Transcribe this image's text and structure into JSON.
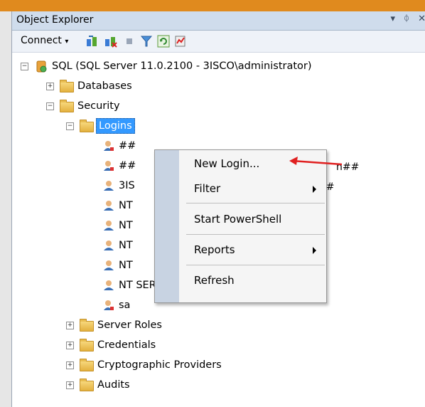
{
  "panel": {
    "title": "Object Explorer",
    "controls": [
      "▾",
      "ᛰ",
      "✕"
    ]
  },
  "toolbar": {
    "connect_label": "Connect",
    "connect_arrow": "▾",
    "icons": [
      "connect-object-explorer-icon",
      "disconnect-icon",
      "stop-icon",
      "filter-icon",
      "refresh-icon",
      "activity-monitor-icon"
    ]
  },
  "tree": {
    "server": "SQL (SQL Server 11.0.2100 - 3ISCO\\administrator)",
    "databases": "Databases",
    "security": "Security",
    "logins": "Logins",
    "login_items": [
      "##",
      "##",
      "3IS",
      "NT",
      "NT",
      "NT",
      "NT",
      "NT SERVICE\\Winmgmt",
      "sa"
    ],
    "login_suffixes": [
      "n##",
      "##"
    ],
    "security_children": [
      "Server Roles",
      "Credentials",
      "Cryptographic Providers",
      "Audits"
    ]
  },
  "context_menu": {
    "items": [
      {
        "label": "New Login...",
        "submenu": false
      },
      {
        "label": "Filter",
        "submenu": true
      },
      {
        "label": "Start PowerShell",
        "submenu": false
      },
      {
        "label": "Reports",
        "submenu": true
      },
      {
        "label": "Refresh",
        "submenu": false
      }
    ]
  },
  "colors": {
    "accent_orange": "#e08a1e",
    "selection_blue": "#3399ff",
    "annotation_red": "#e02020",
    "title_bar": "#cfdcec"
  }
}
